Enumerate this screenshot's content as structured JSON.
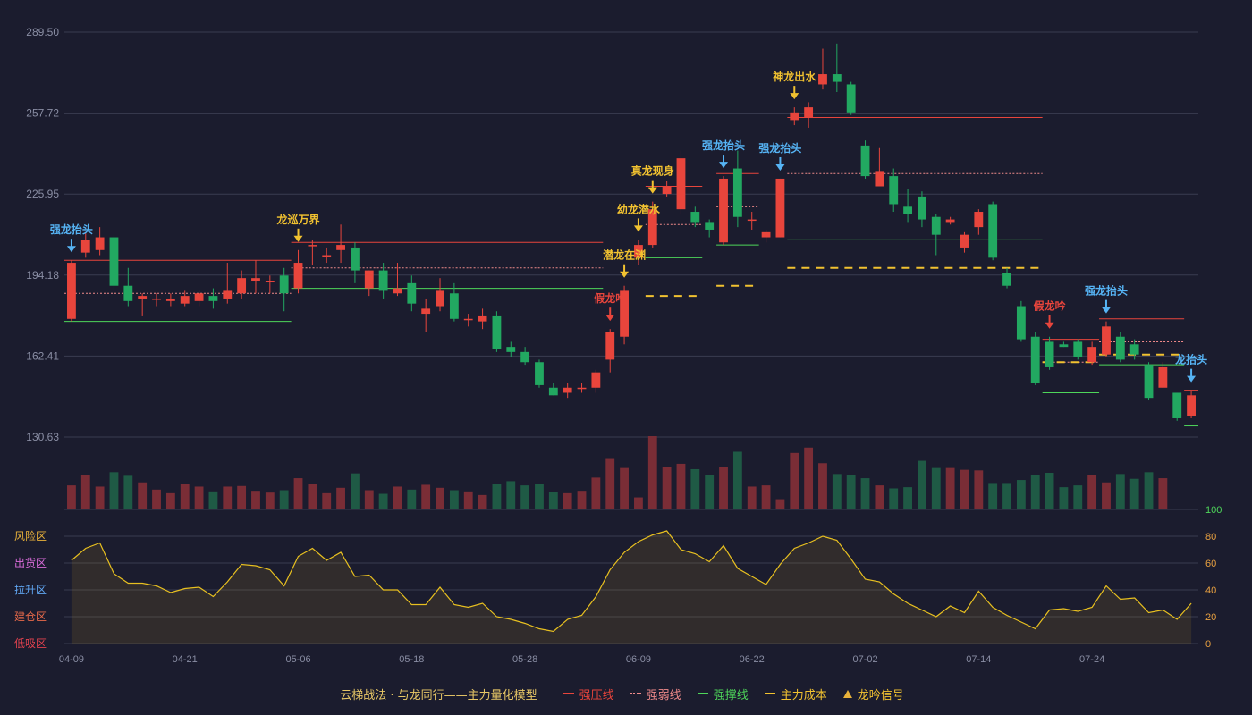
{
  "chart_data": {
    "type": "candlestick",
    "title": "云梯战法 · 与龙同行——主力量化模型",
    "y_ticks": [
      "289.50",
      "257.72",
      "225.95",
      "194.18",
      "162.41",
      "130.63"
    ],
    "y_range": [
      130.63,
      289.5
    ],
    "x_ticks": [
      {
        "index": 0,
        "label": "04-09"
      },
      {
        "index": 8,
        "label": "04-21"
      },
      {
        "index": 16,
        "label": "05-06"
      },
      {
        "index": 24,
        "label": "05-18"
      },
      {
        "index": 32,
        "label": "05-28"
      },
      {
        "index": 40,
        "label": "06-09"
      },
      {
        "index": 48,
        "label": "06-22"
      },
      {
        "index": 56,
        "label": "07-02"
      },
      {
        "index": 64,
        "label": "07-14"
      },
      {
        "index": 72,
        "label": "07-24"
      }
    ],
    "candles": [
      {
        "o": 177,
        "c": 199,
        "h": 200,
        "l": 176
      },
      {
        "o": 203,
        "c": 208,
        "h": 211,
        "l": 201
      },
      {
        "o": 204,
        "c": 209,
        "h": 213,
        "l": 202
      },
      {
        "o": 209,
        "c": 190,
        "h": 210,
        "l": 188
      },
      {
        "o": 190,
        "c": 184,
        "h": 197,
        "l": 182
      },
      {
        "o": 185,
        "c": 186,
        "h": 187,
        "l": 178
      },
      {
        "o": 185,
        "c": 185,
        "h": 187,
        "l": 182
      },
      {
        "o": 184,
        "c": 185,
        "h": 187,
        "l": 182
      },
      {
        "o": 183,
        "c": 186,
        "h": 188,
        "l": 182
      },
      {
        "o": 184,
        "c": 187,
        "h": 188,
        "l": 182
      },
      {
        "o": 186,
        "c": 184,
        "h": 189,
        "l": 181
      },
      {
        "o": 185,
        "c": 188,
        "h": 199,
        "l": 183
      },
      {
        "o": 187,
        "c": 193,
        "h": 196,
        "l": 185
      },
      {
        "o": 192,
        "c": 193,
        "h": 200,
        "l": 187
      },
      {
        "o": 192,
        "c": 192,
        "h": 194,
        "l": 187
      },
      {
        "o": 194,
        "c": 187,
        "h": 197,
        "l": 180
      },
      {
        "o": 189,
        "c": 199,
        "h": 204,
        "l": 187
      },
      {
        "o": 206,
        "c": 206,
        "h": 208,
        "l": 198
      },
      {
        "o": 202,
        "c": 202,
        "h": 205,
        "l": 199
      },
      {
        "o": 204,
        "c": 206,
        "h": 214,
        "l": 199
      },
      {
        "o": 205,
        "c": 196,
        "h": 207,
        "l": 191
      },
      {
        "o": 189,
        "c": 196,
        "h": 196,
        "l": 186
      },
      {
        "o": 196,
        "c": 188,
        "h": 199,
        "l": 185
      },
      {
        "o": 187,
        "c": 189,
        "h": 199,
        "l": 186
      },
      {
        "o": 191,
        "c": 183,
        "h": 194,
        "l": 180
      },
      {
        "o": 179,
        "c": 181,
        "h": 185,
        "l": 172
      },
      {
        "o": 182,
        "c": 188,
        "h": 193,
        "l": 180
      },
      {
        "o": 187,
        "c": 177,
        "h": 191,
        "l": 176
      },
      {
        "o": 177,
        "c": 177,
        "h": 179,
        "l": 174
      },
      {
        "o": 176,
        "c": 178,
        "h": 181,
        "l": 173
      },
      {
        "o": 178,
        "c": 165,
        "h": 180,
        "l": 164
      },
      {
        "o": 166,
        "c": 164,
        "h": 168,
        "l": 162
      },
      {
        "o": 164,
        "c": 160,
        "h": 166,
        "l": 159
      },
      {
        "o": 160,
        "c": 151,
        "h": 161,
        "l": 150
      },
      {
        "o": 150,
        "c": 147,
        "h": 152,
        "l": 147
      },
      {
        "o": 148,
        "c": 150,
        "h": 152,
        "l": 146
      },
      {
        "o": 150,
        "c": 150,
        "h": 152,
        "l": 148
      },
      {
        "o": 150,
        "c": 156,
        "h": 157,
        "l": 148
      },
      {
        "o": 161,
        "c": 172,
        "h": 173,
        "l": 156
      },
      {
        "o": 170,
        "c": 188,
        "h": 190,
        "l": 167
      },
      {
        "o": 201,
        "c": 206,
        "h": 208,
        "l": 198
      },
      {
        "o": 206,
        "c": 220,
        "h": 223,
        "l": 205
      },
      {
        "o": 226,
        "c": 229,
        "h": 231,
        "l": 225
      },
      {
        "o": 220,
        "c": 240,
        "h": 243,
        "l": 218
      },
      {
        "o": 219,
        "c": 215,
        "h": 221,
        "l": 213
      },
      {
        "o": 215,
        "c": 212,
        "h": 216,
        "l": 209
      },
      {
        "o": 207,
        "c": 232,
        "h": 233,
        "l": 206
      },
      {
        "o": 236,
        "c": 217,
        "h": 243,
        "l": 213
      },
      {
        "o": 216,
        "c": 216,
        "h": 219,
        "l": 212
      },
      {
        "o": 209,
        "c": 211,
        "h": 212,
        "l": 207
      },
      {
        "o": 209,
        "c": 232,
        "h": 232,
        "l": 209
      },
      {
        "o": 255,
        "c": 258,
        "h": 260,
        "l": 253
      },
      {
        "o": 256,
        "c": 260,
        "h": 262,
        "l": 252
      },
      {
        "o": 269,
        "c": 273,
        "h": 283,
        "l": 267
      },
      {
        "o": 273,
        "c": 270,
        "h": 285,
        "l": 266
      },
      {
        "o": 269,
        "c": 258,
        "h": 270,
        "l": 257
      },
      {
        "o": 245,
        "c": 233,
        "h": 247,
        "l": 232
      },
      {
        "o": 229,
        "c": 235,
        "h": 244,
        "l": 229
      },
      {
        "o": 233,
        "c": 222,
        "h": 236,
        "l": 219
      },
      {
        "o": 221,
        "c": 218,
        "h": 228,
        "l": 215
      },
      {
        "o": 225,
        "c": 216,
        "h": 227,
        "l": 213
      },
      {
        "o": 217,
        "c": 210,
        "h": 218,
        "l": 202
      },
      {
        "o": 215,
        "c": 216,
        "h": 217,
        "l": 214
      },
      {
        "o": 205,
        "c": 210,
        "h": 211,
        "l": 203
      },
      {
        "o": 213,
        "c": 219,
        "h": 220,
        "l": 210
      },
      {
        "o": 222,
        "c": 201,
        "h": 223,
        "l": 200
      },
      {
        "o": 195,
        "c": 190,
        "h": 197,
        "l": 189
      },
      {
        "o": 182,
        "c": 169,
        "h": 184,
        "l": 168
      },
      {
        "o": 170,
        "c": 152,
        "h": 172,
        "l": 151
      },
      {
        "o": 168,
        "c": 158,
        "h": 170,
        "l": 157
      },
      {
        "o": 167,
        "c": 166,
        "h": 168,
        "l": 166
      },
      {
        "o": 168,
        "c": 162,
        "h": 169,
        "l": 161
      },
      {
        "o": 160,
        "c": 166,
        "h": 168,
        "l": 159
      },
      {
        "o": 163,
        "c": 174,
        "h": 176,
        "l": 162
      },
      {
        "o": 170,
        "c": 161,
        "h": 172,
        "l": 160
      },
      {
        "o": 167,
        "c": 163,
        "h": 169,
        "l": 161
      },
      {
        "o": 159,
        "c": 146,
        "h": 160,
        "l": 145
      },
      {
        "o": 150,
        "c": 158,
        "h": 160,
        "l": 150
      },
      {
        "o": 148,
        "c": 138,
        "h": 148,
        "l": 137
      },
      {
        "o": 139,
        "c": 147,
        "h": 149,
        "l": 138
      }
    ],
    "volume": [
      40,
      58,
      38,
      62,
      56,
      45,
      33,
      27,
      43,
      38,
      30,
      38,
      39,
      31,
      28,
      32,
      52,
      42,
      27,
      36,
      60,
      32,
      26,
      38,
      33,
      41,
      36,
      32,
      30,
      24,
      43,
      47,
      40,
      43,
      29,
      27,
      31,
      53,
      84,
      69,
      20,
      122,
      71,
      76,
      67,
      57,
      71,
      96,
      38,
      40,
      17,
      94,
      103,
      77,
      59,
      57,
      52,
      40,
      35,
      37,
      81,
      69,
      69,
      66,
      65,
      44,
      44,
      49,
      58,
      61,
      37,
      40,
      58,
      45,
      59,
      51,
      62,
      52
    ],
    "oscillator": [
      62,
      71,
      75,
      52,
      45,
      45,
      43,
      38,
      41,
      42,
      35,
      46,
      59,
      58,
      55,
      43,
      65,
      71,
      62,
      68,
      50,
      51,
      40,
      40,
      29,
      29,
      42,
      29,
      27,
      30,
      20,
      18,
      15,
      11,
      9,
      18,
      21,
      35,
      55,
      68,
      76,
      81,
      84,
      70,
      67,
      61,
      73,
      56,
      50,
      44,
      59,
      71,
      75,
      80,
      77,
      63,
      48,
      46,
      37,
      30,
      25,
      20,
      28,
      23,
      39,
      27,
      21,
      16,
      11,
      25,
      26,
      24,
      27,
      43,
      33,
      34,
      23,
      25,
      18,
      30
    ],
    "osc_axis": [
      "100",
      "80",
      "60",
      "40",
      "20",
      "0"
    ],
    "osc_zones": [
      {
        "label": "风险区",
        "color": "#e8b13a"
      },
      {
        "label": "出货区",
        "color": "#d76bd8"
      },
      {
        "label": "拉升区",
        "color": "#5fa3ef"
      },
      {
        "label": "建仓区",
        "color": "#e86a4a"
      },
      {
        "label": "低吸区",
        "color": "#e0424e"
      }
    ],
    "signals": [
      {
        "index": 0,
        "label": "强龙抬头",
        "kind": "strong"
      },
      {
        "index": 16,
        "label": "龙巡万界",
        "kind": "gold"
      },
      {
        "index": 38,
        "label": "假龙吟",
        "kind": "fake"
      },
      {
        "index": 39,
        "label": "潜龙在渊",
        "kind": "gold"
      },
      {
        "index": 40,
        "label": "幼龙潜水",
        "kind": "gold"
      },
      {
        "index": 41,
        "label": "真龙现身",
        "kind": "gold"
      },
      {
        "index": 46,
        "label": "强龙抬头",
        "kind": "strong"
      },
      {
        "index": 50,
        "label": "强龙抬头",
        "kind": "strong"
      },
      {
        "index": 51,
        "label": "神龙出水",
        "kind": "gold"
      },
      {
        "index": 69,
        "label": "假龙吟",
        "kind": "fake"
      },
      {
        "index": 73,
        "label": "强龙抬头",
        "kind": "strong"
      },
      {
        "index": 79,
        "label": "龙抬头",
        "kind": "strong"
      }
    ],
    "levels": [
      {
        "kind": "pressure",
        "from": 0,
        "to": 15,
        "value": 200
      },
      {
        "kind": "weak",
        "from": 0,
        "to": 15,
        "value": 187
      },
      {
        "kind": "support",
        "from": 0,
        "to": 15,
        "value": 176
      },
      {
        "kind": "pressure",
        "from": 16,
        "to": 37,
        "value": 207
      },
      {
        "kind": "weak",
        "from": 16,
        "to": 37,
        "value": 197
      },
      {
        "kind": "support",
        "from": 16,
        "to": 37,
        "value": 189
      },
      {
        "kind": "cost",
        "from": 41,
        "to": 44,
        "value": 186
      },
      {
        "kind": "support",
        "from": 41,
        "to": 44,
        "value": 201
      },
      {
        "kind": "weak",
        "from": 41,
        "to": 44,
        "value": 214
      },
      {
        "kind": "pressure",
        "from": 41,
        "to": 44,
        "value": 229
      },
      {
        "kind": "pressure",
        "from": 46,
        "to": 48,
        "value": 234
      },
      {
        "kind": "weak",
        "from": 46,
        "to": 48,
        "value": 221
      },
      {
        "kind": "support",
        "from": 46,
        "to": 48,
        "value": 206
      },
      {
        "kind": "cost",
        "from": 46,
        "to": 48,
        "value": 190
      },
      {
        "kind": "pressure",
        "from": 51,
        "to": 68,
        "value": 256
      },
      {
        "kind": "weak",
        "from": 51,
        "to": 68,
        "value": 234
      },
      {
        "kind": "support",
        "from": 51,
        "to": 68,
        "value": 208
      },
      {
        "kind": "cost",
        "from": 51,
        "to": 68,
        "value": 197
      },
      {
        "kind": "pressure",
        "from": 69,
        "to": 72,
        "value": 169
      },
      {
        "kind": "weak",
        "from": 69,
        "to": 72,
        "value": 160
      },
      {
        "kind": "support",
        "from": 69,
        "to": 72,
        "value": 148
      },
      {
        "kind": "cost",
        "from": 69,
        "to": 72,
        "value": 160
      },
      {
        "kind": "pressure",
        "from": 73,
        "to": 78,
        "value": 177
      },
      {
        "kind": "weak",
        "from": 73,
        "to": 78,
        "value": 168
      },
      {
        "kind": "support",
        "from": 73,
        "to": 78,
        "value": 159
      },
      {
        "kind": "cost",
        "from": 73,
        "to": 78,
        "value": 163
      },
      {
        "kind": "pressure",
        "from": 79,
        "to": 79,
        "value": 149
      },
      {
        "kind": "support",
        "from": 79,
        "to": 79,
        "value": 135
      }
    ],
    "colors": {
      "up": "#e8453c",
      "down": "#22a861",
      "pressure": "#e8453c",
      "weak": "#f08a8a",
      "support": "#4ed65a",
      "cost": "#f2c230",
      "signal_gold": "#f2c230",
      "signal_strong": "#56b4f5",
      "signal_fake": "#e8453c",
      "osc_line": "#e8c020",
      "grid": "#3a3c50",
      "axis_text": "#8a8ea4",
      "osc_right_top": "#4ed65a",
      "osc_right": "#e8a040"
    }
  },
  "legend": {
    "title": "云梯战法 · 与龙同行——主力量化模型",
    "pressure": "强压线",
    "weak": "强弱线",
    "support": "强撑线",
    "cost": "主力成本",
    "signal": "龙吟信号"
  }
}
